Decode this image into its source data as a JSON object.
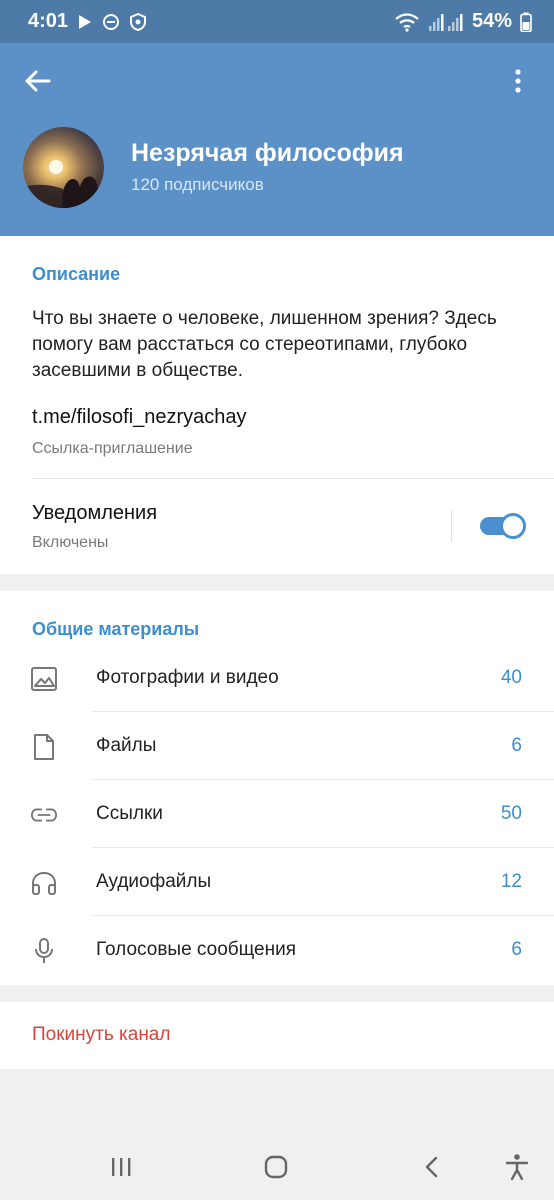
{
  "status_bar": {
    "time": "4:01",
    "battery": "54%",
    "icons": [
      "play-icon",
      "dnd-icon",
      "shield-icon",
      "wifi-icon",
      "signal-icon",
      "battery-icon"
    ]
  },
  "header": {
    "title": "Незрячая философия",
    "subtitle": "120 подписчиков",
    "background_color": "#5b91c6"
  },
  "info": {
    "description_title": "Описание",
    "description_text": "Что вы знаете о человеке, лишенном зрения? Здесь помогу вам расстаться со стереотипами, глубоко засевшими в обществе.",
    "invite_link": "t.me/filosofi_nezryachay",
    "invite_caption": "Ссылка-приглашение",
    "notifications_title": "Уведомления",
    "notifications_status": "Включены",
    "notifications_on": true
  },
  "media": {
    "title": "Общие материалы",
    "items": [
      {
        "label": "Фотографии и видео",
        "count": "40",
        "icon": "photo-icon"
      },
      {
        "label": "Файлы",
        "count": "6",
        "icon": "file-icon"
      },
      {
        "label": "Ссылки",
        "count": "50",
        "icon": "link-icon"
      },
      {
        "label": "Аудиофайлы",
        "count": "12",
        "icon": "headphones-icon"
      },
      {
        "label": "Голосовые сообщения",
        "count": "6",
        "icon": "microphone-icon"
      }
    ]
  },
  "leave": {
    "label": "Покинуть канал",
    "color": "#d9453c"
  },
  "colors": {
    "accent": "#3d8ecf",
    "status_bar": "#4d7aa6"
  }
}
